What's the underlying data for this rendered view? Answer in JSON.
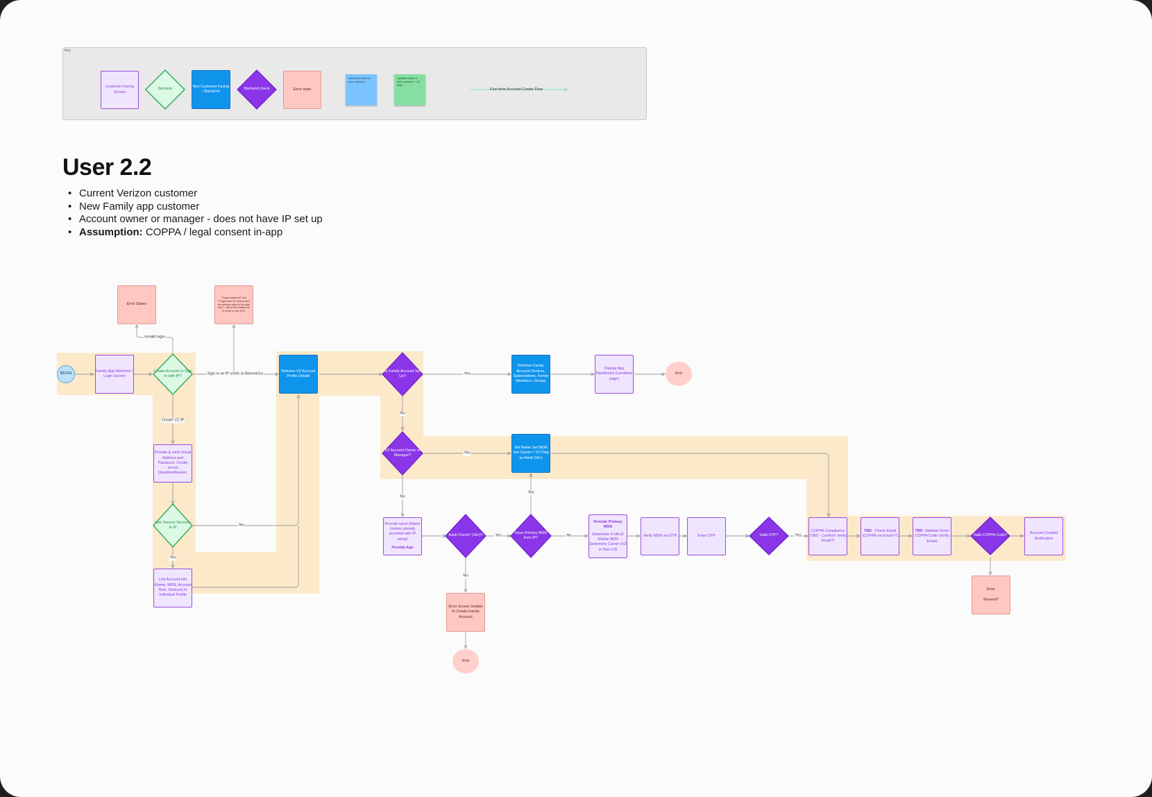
{
  "title": "User 2.2",
  "bullets": [
    "Current Verizon customer",
    "New Family app customer",
    "Account owner or manager - does not have IP set up"
  ],
  "bullets_assumption": {
    "label": "Assumption:",
    "text": "COPPA / legal consent in-app"
  },
  "legend": {
    "key_label": "Key",
    "customer_screen": "Customer Facing Screen",
    "decision": "Decision",
    "non_customer": "Non Customer Facing / BackEnd",
    "backend": "Backend check",
    "error_state": "Error state",
    "sticky_blue": "Additional Notes or open question",
    "sticky_green": "Updated Notes or open question + VZ team",
    "first_time_flow": "First time Account Create Flow"
  },
  "nodes": {
    "begin": "BEGIN",
    "welcome": "Family App Welcome / Login Screen",
    "create_sign": "Create Account or Sign In with IP?",
    "error_states": "Error States",
    "forgot_password": "\"Forgot password\" and \"Forgot User ID\" should take the authors rather of the sign flow? - with a link enabled as in email or own SSO",
    "retrieve_vz": "Retrieve VZ Account Profile Details",
    "is_family": "Is Family Account Set Up?",
    "retrieve_family": "Retrieve Family Account Devices, Subscriptions, Family Members, Groups",
    "display_dashboard": "Display App Dashboard (Locations page)",
    "end_top": "End",
    "vz_owner": "VZ Account Owner or Manager?",
    "set_name": "Set Name Set MDN Set Carrier = VZ Flag as Adult (18+)",
    "provide_verify": "Provide & verify Email Address and Password. Create secret Question/Answer.",
    "link_verizon": "Link Verizon Services to IP",
    "link_account_info": "Link Account Info (Name, MDN, Account Role, Devices) to Individual Profile",
    "provide_name": "Provide name (Name (unless already provided with IP setup)",
    "provide_age": "Provide Age",
    "adult_check": "Adult Check? (18+)?",
    "have_primary": "Have Primary MDN from IP?",
    "error_unable": "Error Screen Unable to Create Family Account",
    "end_bottom": "End",
    "provide_primary_title": "Provide Primary MDN",
    "provide_primary_detail": "Determine if VALID Mobile MDN Determine Carrier (VZ or Non-VZ)",
    "verify_mdn": "Verify MDN via OTP",
    "enter_otp": "Enter OTP",
    "valid_otp": "Valid OTP?",
    "coppa": "COPPA Compliance (TBD - Confirm! Verify Email?)",
    "tbd_check_label": "TBD",
    "tbd_check_text": " - Check Email (COPPA via Email+?)",
    "tbd_validate_label": "TBD",
    "tbd_validate_text": "- Validate/ Enter COPPA Code (Verify Email)",
    "valid_coppa": "Valid COPPA Code?",
    "account_created": "Account Created Notification",
    "error_resend_1": "Error",
    "error_resend_2": "Resend?"
  },
  "labels": {
    "invalid_login": "Invalid login",
    "sign_in_ip": "Sign in w/ IP creds or Biometrics",
    "create_vz_ip": "Create VZ IP",
    "yes_1": "Yes",
    "no_1": "No",
    "yes_2": "Yes",
    "no_2": "No",
    "no_3": "No",
    "yes_3": "Yes",
    "yes_4": "Yes",
    "no_4": "No",
    "yes_5": "Yes",
    "no_5": "No",
    "yes_6": "Yes"
  },
  "colors": {
    "screen_fill": "#f0e5ff",
    "screen_border": "#9a4be0",
    "backend_purple": "#8a35e8",
    "non_customer_blue": "#0f94ec",
    "decision_green": "#2ea65a",
    "error_pink": "#ffc7c1",
    "highlight_lane": "#fbe9c9"
  }
}
